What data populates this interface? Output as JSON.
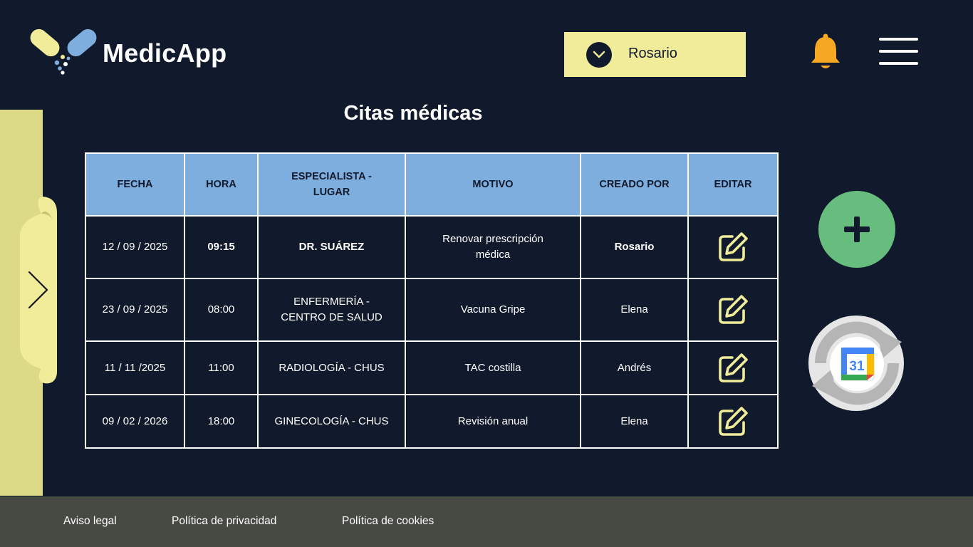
{
  "app": {
    "name": "MedicApp"
  },
  "header": {
    "selected_user": "Rosario",
    "icons": {
      "user_dropdown": "chevron-down-icon",
      "notifications": "bell-icon",
      "menu": "hamburger-menu-icon"
    }
  },
  "side_tab": {
    "icon": "chevron-right-icon"
  },
  "page": {
    "title": "Citas médicas"
  },
  "table": {
    "columns": [
      "FECHA",
      "HORA",
      "ESPECIALISTA - LUGAR",
      "MOTIVO",
      "CREADO POR",
      "EDITAR"
    ],
    "rows": [
      {
        "fecha": "12 / 09 / 2025",
        "hora": "09:15",
        "especialista": "DR. SUÁREZ",
        "motivo": "Renovar prescripción médica",
        "creado_por": "Rosario"
      },
      {
        "fecha": "23 / 09 / 2025",
        "hora": "08:00",
        "especialista": "ENFERMERÍA - CENTRO DE SALUD",
        "motivo": "Vacuna Gripe",
        "creado_por": "Elena"
      },
      {
        "fecha": "11 / 11 /2025",
        "hora": "11:00",
        "especialista": "RADIOLOGÍA - CHUS",
        "motivo": "TAC costilla",
        "creado_por": "Andrés"
      },
      {
        "fecha": "09 / 02 / 2026",
        "hora": "18:00",
        "especialista": "GINECOLOGÍA - CHUS",
        "motivo": "Revisión anual",
        "creado_por": "Elena"
      }
    ],
    "edit_icon": "edit-pencil-square-icon"
  },
  "actions": {
    "add_icon": "plus-icon",
    "sync_icon": "calendar-sync-icon",
    "calendar_day": "31"
  },
  "footer": {
    "links": [
      "Aviso legal",
      "Política de privacidad",
      "Política de cookies"
    ]
  },
  "colors": {
    "background": "#111a2c",
    "accent_yellow": "#f0ec9a",
    "side_strip": "#dcd987",
    "table_header": "#7eaede",
    "add_button": "#67bd7d",
    "bell": "#f7a823",
    "footer": "#474a42"
  }
}
